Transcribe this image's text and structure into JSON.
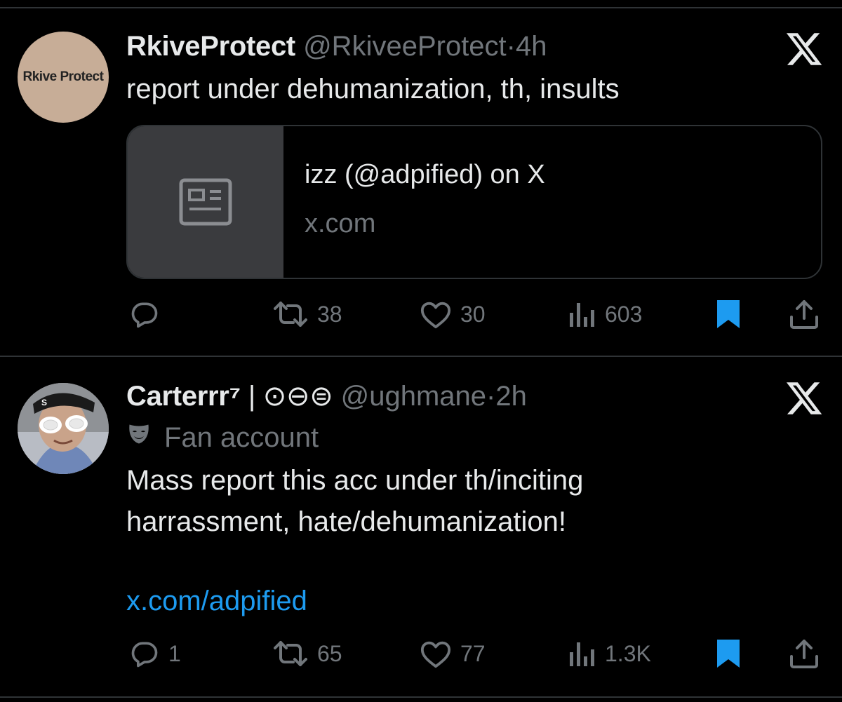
{
  "tweets": [
    {
      "avatar_text": "Rkive Protect",
      "display_name": "RkiveProtect",
      "handle": "@RkiveeProtect",
      "separator": "·",
      "time": "4h",
      "text_lines": [
        "report under dehumanization, th, insults"
      ],
      "card": {
        "title": "izz (@adpified) on X",
        "domain": "x.com"
      },
      "actions": {
        "reply_count": "",
        "retweet_count": "38",
        "like_count": "30",
        "view_count": "603"
      }
    },
    {
      "display_name": "Carterrr⁷",
      "name_suffix": "| ⊙⊖⊜",
      "handle": "@ughmane",
      "separator": "·",
      "time": "2h",
      "label": "Fan account",
      "text_lines": [
        "Mass report this acc under th/inciting",
        "harrassment, hate/dehumanization!"
      ],
      "link_text": "x.com/adpified",
      "actions": {
        "reply_count": "1",
        "retweet_count": "65",
        "like_count": "77",
        "view_count": "1.3K"
      }
    }
  ],
  "colors": {
    "background": "#000000",
    "text_primary": "#e7e9ea",
    "text_secondary": "#71767b",
    "accent": "#1d9bf0",
    "divider": "#2f3336"
  },
  "icons": [
    "x-logo-icon",
    "article-icon",
    "reply-icon",
    "retweet-icon",
    "like-icon",
    "views-icon",
    "bookmark-icon",
    "share-icon",
    "fan-account-mask-icon"
  ]
}
